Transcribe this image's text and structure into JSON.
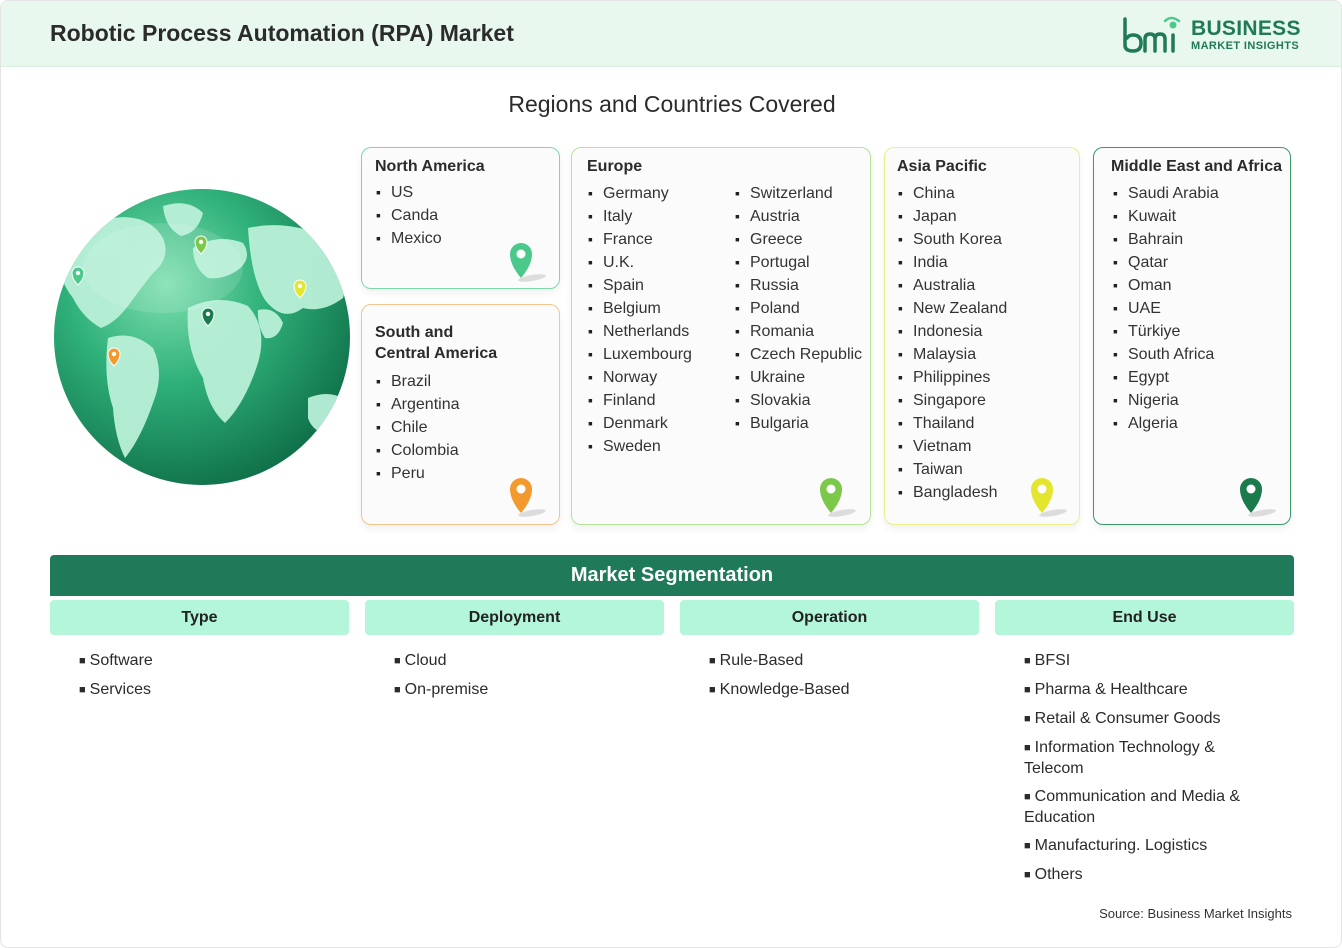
{
  "header": {
    "title": "Robotic Process Automation (RPA) Market",
    "logo_line1": "BUSINESS",
    "logo_line2": "MARKET INSIGHTS",
    "logo_mark": "bmi"
  },
  "regions_title": "Regions and Countries Covered",
  "regions": {
    "north_america": {
      "title": "North America",
      "items": [
        "US",
        "Canda",
        "Mexico"
      ],
      "color": "#4ac98a"
    },
    "south_america": {
      "title_line1": "South and",
      "title_line2": "Central America",
      "items": [
        "Brazil",
        "Argentina",
        "Chile",
        "Colombia",
        "Peru"
      ],
      "color": "#f29a2e"
    },
    "europe": {
      "title": "Europe",
      "col1": [
        "Germany",
        "Italy",
        "France",
        "U.K.",
        "Spain",
        "Belgium",
        "Netherlands",
        "Luxembourg",
        "Norway",
        "Finland",
        "Denmark",
        "Sweden"
      ],
      "col2": [
        "Switzerland",
        "Austria",
        "Greece",
        "Portugal",
        "Russia",
        "Poland",
        "Romania",
        "Czech Republic",
        "Ukraine",
        "Slovakia",
        "Bulgaria"
      ],
      "color": "#7cc84a"
    },
    "asia_pacific": {
      "title": "Asia Pacific",
      "items": [
        "China",
        "Japan",
        "South Korea",
        "India",
        "Australia",
        "New Zealand",
        "Indonesia",
        "Malaysia",
        "Philippines",
        "Singapore",
        "Thailand",
        "Vietnam",
        "Taiwan",
        "Bangladesh"
      ],
      "color": "#e3e52e"
    },
    "mea": {
      "title": "Middle East and Africa",
      "items": [
        "Saudi Arabia",
        "Kuwait",
        "Bahrain",
        "Qatar",
        "Oman",
        "UAE",
        "Türkiye",
        "South Africa",
        "Egypt",
        "Nigeria",
        "Algeria"
      ],
      "color": "#1a7a4c"
    }
  },
  "segmentation": {
    "title": "Market Segmentation",
    "columns": [
      {
        "label": "Type",
        "items": [
          "Software",
          "Services"
        ]
      },
      {
        "label": "Deployment",
        "items": [
          "Cloud",
          "On-premise"
        ]
      },
      {
        "label": "Operation",
        "items": [
          "Rule-Based",
          "Knowledge-Based"
        ]
      },
      {
        "label": "End Use",
        "items": [
          "BFSI",
          "Pharma & Healthcare",
          "Retail & Consumer Goods",
          "Information Technology & Telecom",
          "Communication and Media & Education",
          "Manufacturing. Logistics",
          "Others"
        ]
      }
    ]
  },
  "source": "Source: Business Market Insights",
  "colors": {
    "brand": "#1e7a58",
    "header_bg": "#e8f8ef",
    "seg_head_bg": "#b4f6d9"
  }
}
